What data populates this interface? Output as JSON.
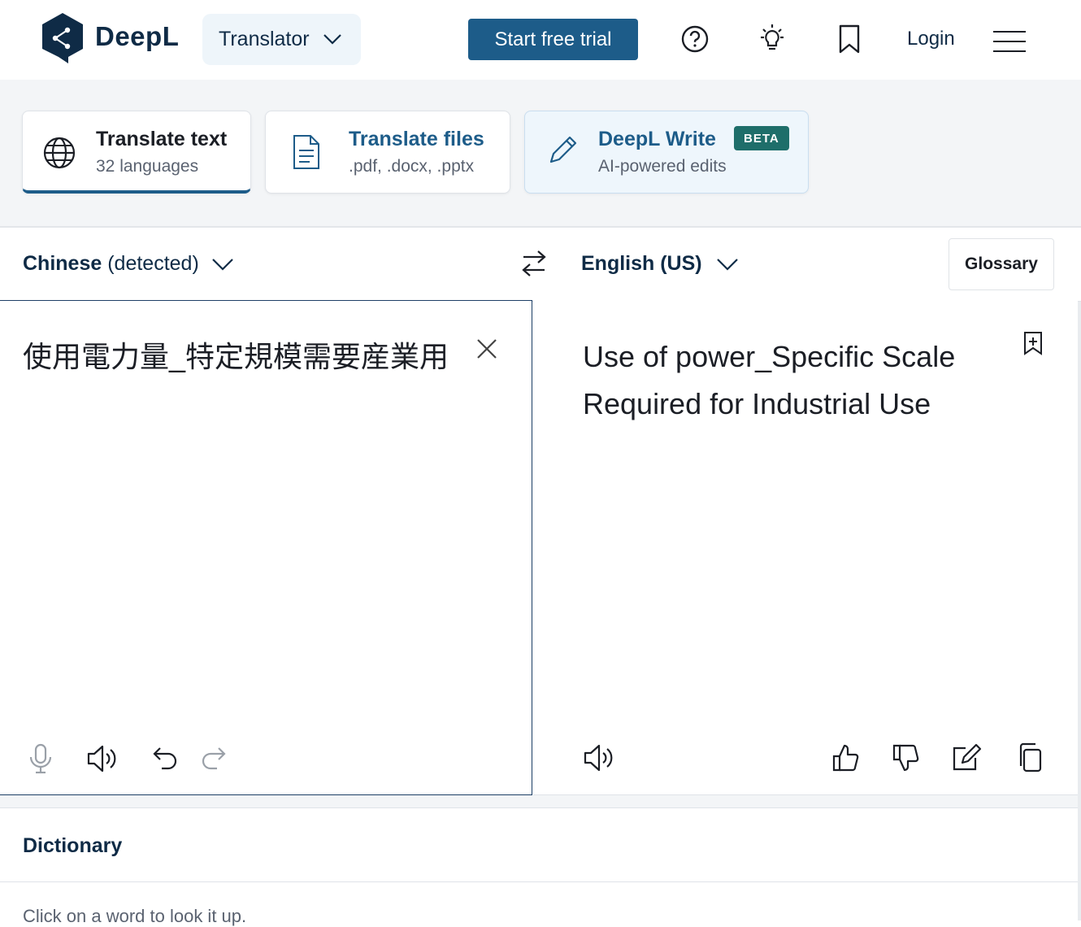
{
  "header": {
    "brand": "DeepL",
    "product_dropdown": "Translator",
    "trial_button": "Start free trial",
    "login": "Login",
    "icons": [
      "help-icon",
      "lightbulb-icon",
      "bookmark-icon",
      "menu-icon"
    ]
  },
  "modes": [
    {
      "title": "Translate text",
      "subtitle": "32 languages",
      "icon": "globe-icon"
    },
    {
      "title": "Translate files",
      "subtitle": ".pdf, .docx, .pptx",
      "icon": "document-icon"
    },
    {
      "title": "DeepL Write",
      "badge": "BETA",
      "subtitle": "AI-powered edits",
      "icon": "pencil-icon"
    }
  ],
  "source": {
    "language": "Chinese",
    "detected_suffix": "(detected)",
    "text": "使用電力量_特定規模需要産業用"
  },
  "target": {
    "language": "English (US)",
    "glossary": "Glossary",
    "text": "Use of power_Specific Scale Required for Industrial Use"
  },
  "dictionary": {
    "title": "Dictionary",
    "hint": "Click on a word to look it up."
  },
  "colors": {
    "brand_navy": "#0f2b46",
    "accent_blue": "#1d5c89",
    "beta_badge": "#1e6e6a",
    "panel_bg": "#f3f5f7"
  }
}
